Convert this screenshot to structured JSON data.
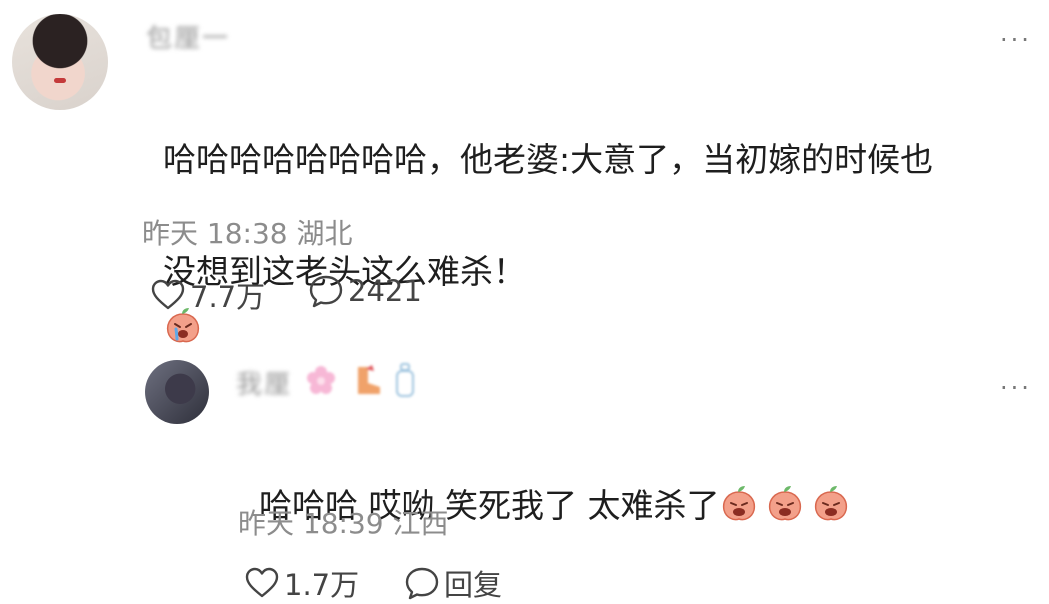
{
  "comment": {
    "username": "包厘一",
    "more_label": "···",
    "text_line1": "哈哈哈哈哈哈哈哈，他老婆:大意了，当初嫁的时候也",
    "text_line2": "没想到这老头这么难杀！",
    "emoji": "crying-peach-emoji",
    "time": "昨天 18:38",
    "location": "湖北",
    "likes": "7.7万",
    "replies": "2421"
  },
  "reply": {
    "username": "我厘",
    "more_label": "···",
    "text": "哈哈哈 哎呦 笑死我了 太难杀了",
    "emoji": "crying-peach-emoji",
    "emoji_count": 3,
    "time": "昨天 18:39",
    "location": "江西",
    "likes": "1.7万",
    "reply_label": "回复"
  }
}
